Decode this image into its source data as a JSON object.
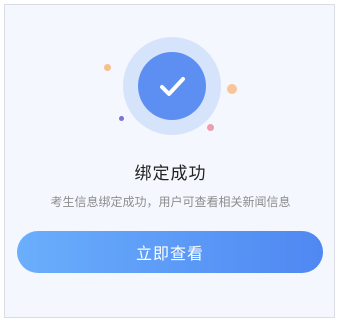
{
  "result": {
    "status_icon": "check-icon",
    "title": "绑定成功",
    "message": "考生信息绑定成功，用户可查看相关新闻信息"
  },
  "actions": {
    "view_now_label": "立即查看"
  },
  "colors": {
    "accent": "#5d8ff3",
    "button_gradient_start": "#6aaefc",
    "button_gradient_end": "#4f88f2",
    "halo": "#d6e4fb",
    "background": "#f4f7fd"
  }
}
